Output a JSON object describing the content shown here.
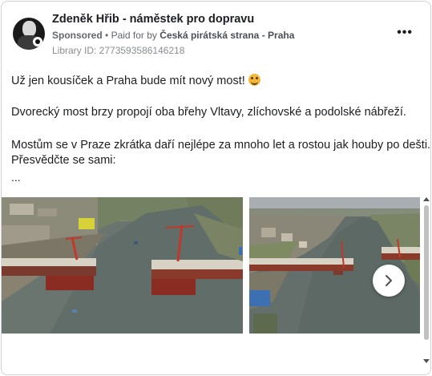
{
  "ad": {
    "page_name": "Zdeněk Hřib - náměstek pro dopravu",
    "sponsored": "Sponsored",
    "separator": "•",
    "paid_for_by": "Paid for by",
    "payer": "Česká pirátská strana - Praha",
    "library_id": "Library ID: 2773593586146218",
    "more_icon": "more-options-icon",
    "avatar_icon": "profile-avatar"
  },
  "post": {
    "line1": "Už jen kousíček a Praha bude mít nový most!",
    "emoji": "smiling-face-emoji",
    "line2": "Dvorecký most brzy propojí oba břehy Vltavy, zlíchovské a podolské nábřeží.",
    "line3": "Mostům se v Praze zkrátka daří nejlépe za mnoho let a rostou jak houby po dešti.",
    "line4": "Přesvědčte se sami:",
    "ellipsis": "..."
  },
  "carousel": {
    "image1": "aerial-photo-bridge-construction-river",
    "image2": "aerial-photo-bridge-construction-river-wide",
    "next_icon": "chevron-right-icon"
  },
  "colors": {
    "text": "#1c1e21",
    "meta": "#65676b",
    "water": "#5f6a64",
    "bridge_red": "#c0392b"
  }
}
